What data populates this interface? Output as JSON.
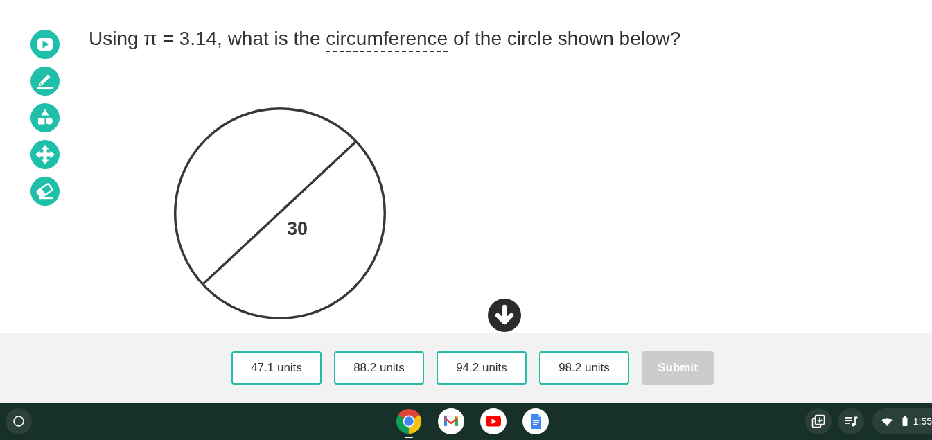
{
  "question": {
    "segments": [
      {
        "kind": "plain",
        "text": "Using π = 3.14, what is the "
      },
      {
        "kind": "term",
        "text": "circumference"
      },
      {
        "kind": "plain",
        "text": " of the circle shown below?"
      }
    ]
  },
  "figure": {
    "diameter_label": "30"
  },
  "answer_bar": {
    "choices": [
      {
        "label": "47.1 units",
        "selected": false
      },
      {
        "label": "88.2 units",
        "selected": false
      },
      {
        "label": "94.2 units",
        "selected": false
      },
      {
        "label": "98.2 units",
        "selected": false
      }
    ],
    "submit": {
      "label": "Submit",
      "disabled": true
    }
  },
  "taskbar": {
    "apps": [
      {
        "running": true
      },
      {
        "running": false
      },
      {
        "running": false
      },
      {
        "running": false
      }
    ],
    "clock": "1:55"
  }
}
